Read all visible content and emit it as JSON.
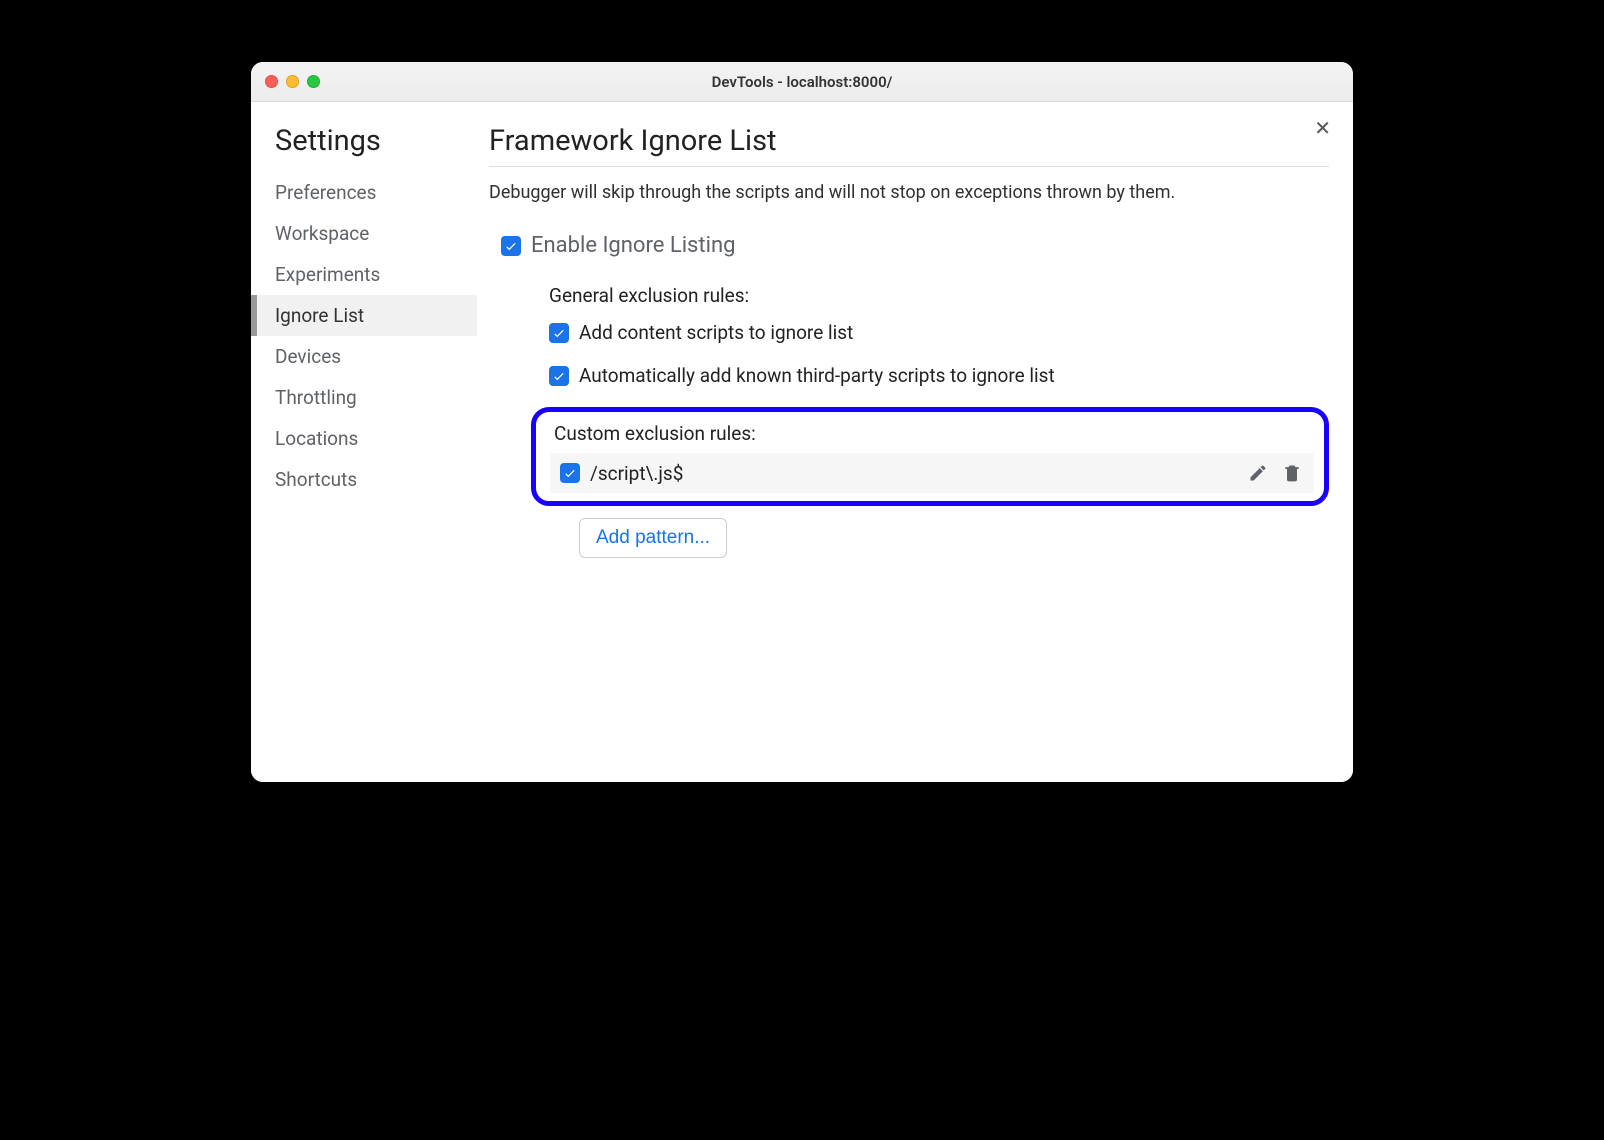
{
  "window": {
    "title": "DevTools - localhost:8000/"
  },
  "sidebar": {
    "title": "Settings",
    "items": [
      {
        "label": "Preferences",
        "selected": false
      },
      {
        "label": "Workspace",
        "selected": false
      },
      {
        "label": "Experiments",
        "selected": false
      },
      {
        "label": "Ignore List",
        "selected": true
      },
      {
        "label": "Devices",
        "selected": false
      },
      {
        "label": "Throttling",
        "selected": false
      },
      {
        "label": "Locations",
        "selected": false
      },
      {
        "label": "Shortcuts",
        "selected": false
      }
    ]
  },
  "main": {
    "title": "Framework Ignore List",
    "description": "Debugger will skip through the scripts and will not stop on exceptions thrown by them.",
    "enable_label": "Enable Ignore Listing",
    "enable_checked": true,
    "general_section_label": "General exclusion rules:",
    "general_rules": [
      {
        "label": "Add content scripts to ignore list",
        "checked": true
      },
      {
        "label": "Automatically add known third-party scripts to ignore list",
        "checked": true
      }
    ],
    "custom_section_label": "Custom exclusion rules:",
    "custom_rules": [
      {
        "pattern": "/script\\.js$",
        "checked": true
      }
    ],
    "add_pattern_label": "Add pattern..."
  }
}
